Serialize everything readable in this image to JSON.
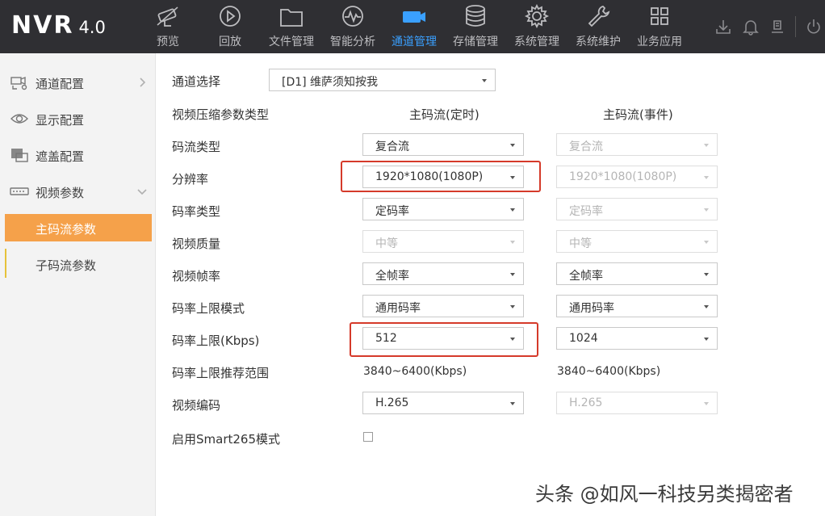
{
  "app": {
    "logo_text": "NVR",
    "version": "4.0"
  },
  "nav": [
    {
      "label": "预览",
      "icon": "preview-camera-icon"
    },
    {
      "label": "回放",
      "icon": "playback-icon"
    },
    {
      "label": "文件管理",
      "icon": "folder-icon"
    },
    {
      "label": "智能分析",
      "icon": "analytics-icon"
    },
    {
      "label": "通道管理",
      "icon": "camera-channel-icon",
      "active": true
    },
    {
      "label": "存储管理",
      "icon": "database-icon"
    },
    {
      "label": "系统管理",
      "icon": "gear-icon"
    },
    {
      "label": "系统维护",
      "icon": "wrench-icon"
    },
    {
      "label": "业务应用",
      "icon": "grid-apps-icon"
    }
  ],
  "toolbar_icons": [
    "download-icon",
    "bell-icon",
    "export-icon",
    "power-icon"
  ],
  "sidebar": {
    "items": [
      {
        "label": "通道配置",
        "icon": "channel-config-icon"
      },
      {
        "label": "显示配置",
        "icon": "eye-icon"
      },
      {
        "label": "遮盖配置",
        "icon": "mask-icon"
      },
      {
        "label": "视频参数",
        "icon": "video-param-icon"
      }
    ],
    "subitems": [
      {
        "label": "主码流参数",
        "active": true
      },
      {
        "label": "子码流参数",
        "active": false
      }
    ]
  },
  "main": {
    "channel_label": "通道选择",
    "channel_value": "[D1] 维萨须知按我",
    "param_type_label": "视频压缩参数类型",
    "col1_header": "主码流(定时)",
    "col2_header": "主码流(事件)",
    "rows": [
      {
        "label": "码流类型",
        "col1": "复合流",
        "col2": "复合流"
      },
      {
        "label": "分辨率",
        "col1": "1920*1080(1080P)",
        "col2": "1920*1080(1080P)"
      },
      {
        "label": "码率类型",
        "col1": "定码率",
        "col2": "定码率"
      },
      {
        "label": "视频质量",
        "col1": "中等",
        "col2": "中等"
      },
      {
        "label": "视频帧率",
        "col1": "全帧率",
        "col2": "全帧率"
      },
      {
        "label": "码率上限模式",
        "col1": "通用码率",
        "col2": "通用码率"
      },
      {
        "label": "码率上限(Kbps)",
        "col1": "512",
        "col2": "1024"
      },
      {
        "label": "码率上限推荐范围",
        "col1": "3840~6400(Kbps)",
        "col2": "3840~6400(Kbps)"
      },
      {
        "label": "视频编码",
        "col1": "H.265",
        "col2": "H.265"
      }
    ],
    "smart_label": "启用Smart265模式",
    "smart_checked": false
  },
  "watermark": "头条 @如风一科技另类揭密者",
  "colors": {
    "topbar": "#2f2f33",
    "active_nav": "#3aa0ff",
    "active_sub": "#f5a14a",
    "highlight": "#d53a2a"
  }
}
